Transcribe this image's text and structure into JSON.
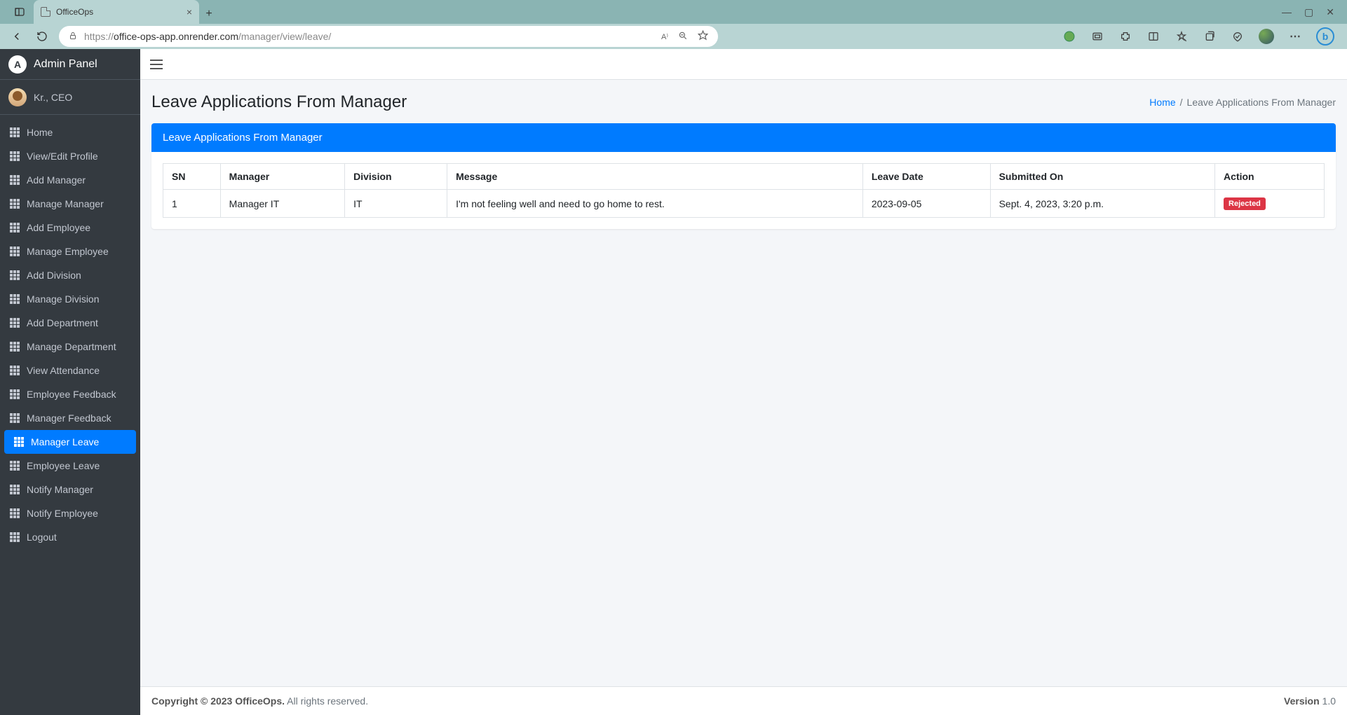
{
  "browser": {
    "tab_title": "OfficeOps",
    "url_prefix": "https://",
    "url_host": "office-ops-app.onrender.com",
    "url_path": "/manager/view/leave/"
  },
  "sidebar": {
    "brand": "Admin Panel",
    "user": "Kr., CEO",
    "items": [
      {
        "label": "Home"
      },
      {
        "label": "View/Edit Profile"
      },
      {
        "label": "Add Manager"
      },
      {
        "label": "Manage Manager"
      },
      {
        "label": "Add Employee"
      },
      {
        "label": "Manage Employee"
      },
      {
        "label": "Add Division"
      },
      {
        "label": "Manage Division"
      },
      {
        "label": "Add Department"
      },
      {
        "label": "Manage Department"
      },
      {
        "label": "View Attendance"
      },
      {
        "label": "Employee Feedback"
      },
      {
        "label": "Manager Feedback"
      },
      {
        "label": "Manager Leave"
      },
      {
        "label": "Employee Leave"
      },
      {
        "label": "Notify Manager"
      },
      {
        "label": "Notify Employee"
      },
      {
        "label": "Logout"
      }
    ],
    "active_index": 13
  },
  "page": {
    "title": "Leave Applications From Manager",
    "breadcrumb_home": "Home",
    "breadcrumb_sep": "/",
    "breadcrumb_current": "Leave Applications From Manager"
  },
  "card": {
    "header": "Leave Applications From Manager",
    "columns": [
      "SN",
      "Manager",
      "Division",
      "Message",
      "Leave Date",
      "Submitted On",
      "Action"
    ],
    "rows": [
      {
        "sn": "1",
        "manager": "Manager IT",
        "division": "IT",
        "message": "I'm not feeling well and need to go home to rest.",
        "leave_date": "2023-09-05",
        "submitted_on": "Sept. 4, 2023, 3:20 p.m.",
        "action_label": "Rejected",
        "action_class": "badge-danger"
      }
    ]
  },
  "footer": {
    "copyright_bold": "Copyright © 2023 OfficeOps.",
    "copyright_rest": " All rights reserved.",
    "version_label": "Version",
    "version_value": " 1.0"
  }
}
